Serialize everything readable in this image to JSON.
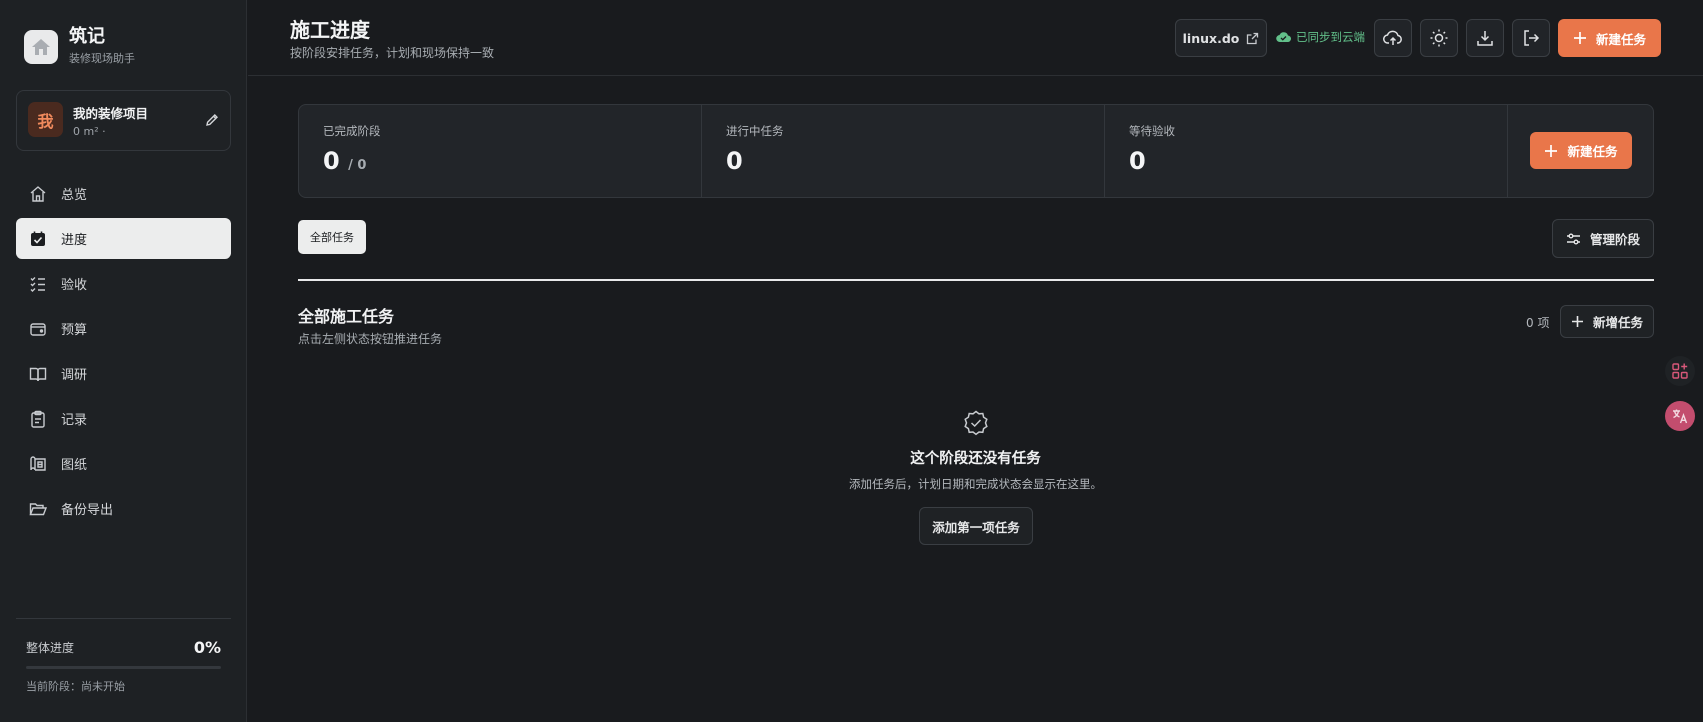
{
  "sidebar": {
    "brand_name": "筑记",
    "brand_sub": "装修现场助手",
    "project": {
      "avatar": "我",
      "name": "我的装修项目",
      "meta": "0 m² ·"
    },
    "nav": [
      {
        "label": "总览",
        "icon": "home-icon"
      },
      {
        "label": "进度",
        "icon": "calendar-check-icon",
        "active": true
      },
      {
        "label": "验收",
        "icon": "checklist-icon"
      },
      {
        "label": "预算",
        "icon": "wallet-icon"
      },
      {
        "label": "调研",
        "icon": "book-open-icon"
      },
      {
        "label": "记录",
        "icon": "clipboard-icon"
      },
      {
        "label": "图纸",
        "icon": "blueprint-icon"
      },
      {
        "label": "备份导出",
        "icon": "folder-open-icon"
      }
    ],
    "footer": {
      "progress_label": "整体进度",
      "progress_value": "0%",
      "progress_fraction": 0,
      "current_stage": "当前阶段：尚未开始"
    }
  },
  "header": {
    "title": "施工进度",
    "subtitle": "按阶段安排任务，计划和现场保持一致",
    "link_label": "linux.do",
    "sync_status": "已同步到云端",
    "new_task_label": "新建任务"
  },
  "stats": {
    "completed_label": "已完成阶段",
    "completed_value": "0",
    "completed_total": "/ 0",
    "in_progress_label": "进行中任务",
    "in_progress_value": "0",
    "pending_label": "等待验收",
    "pending_value": "0",
    "new_task_label": "新建任务"
  },
  "filters": {
    "all_label": "全部任务",
    "manage_label": "管理阶段"
  },
  "section": {
    "title": "全部施工任务",
    "subtitle": "点击左侧状态按钮推进任务",
    "count": "0 项",
    "add_label": "新增任务"
  },
  "empty": {
    "title": "这个阶段还没有任务",
    "subtitle": "添加任务后，计划日期和完成状态会显示在这里。",
    "cta": "添加第一项任务"
  },
  "colors": {
    "accent": "#e9764a",
    "sync": "#62c08a",
    "background": "#191b1e"
  }
}
